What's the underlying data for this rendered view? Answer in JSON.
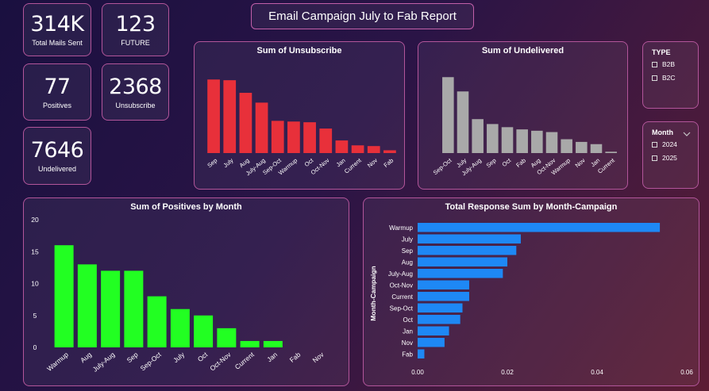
{
  "report": {
    "title": "Email Campaign July to Fab Report"
  },
  "kpis": [
    {
      "value": "314K",
      "label": "Total Mails Sent"
    },
    {
      "value": "123",
      "label": "FUTURE"
    },
    {
      "value": "77",
      "label": "Positives"
    },
    {
      "value": "2368",
      "label": "Unsubscribe"
    },
    {
      "value": "7646",
      "label": "Undelivered"
    }
  ],
  "slicers": {
    "type": {
      "header": "TYPE",
      "options": [
        "B2B",
        "B2C"
      ]
    },
    "month": {
      "header": "Month",
      "options": [
        "2024",
        "2025"
      ]
    }
  },
  "colors": {
    "unsubscribe": "#e8303a",
    "undelivered": "#a9a9a9",
    "positives": "#22ff22",
    "response": "#1e88f5"
  },
  "chart_data": [
    {
      "type": "bar",
      "title": "Sum of Unsubscribe",
      "categories": [
        "Sep",
        "July",
        "Aug",
        "July-Aug",
        "Sep-Oct",
        "Warmup",
        "Oct",
        "Oct-Nov",
        "Jan",
        "Current",
        "Nov",
        "Fab"
      ],
      "values": [
        525,
        520,
        430,
        360,
        230,
        225,
        220,
        175,
        90,
        55,
        50,
        20
      ],
      "ylim": [
        0,
        600
      ],
      "grid": false
    },
    {
      "type": "bar",
      "title": "Sum of Undelivered",
      "categories": [
        "Sep-Oct",
        "July",
        "July-Aug",
        "Sep",
        "Oct",
        "Fab",
        "Aug",
        "Oct-Nov",
        "Warmup",
        "Nov",
        "Jan",
        "Current"
      ],
      "values": [
        1700,
        1380,
        760,
        650,
        580,
        530,
        500,
        470,
        310,
        250,
        200,
        30
      ],
      "ylim": [
        0,
        1900
      ],
      "grid": false
    },
    {
      "type": "bar",
      "title": "Sum of Positives by Month",
      "categories": [
        "Warmup",
        "Aug",
        "July-Aug",
        "Sep",
        "Sep-Oct",
        "July",
        "Oct",
        "Oct-Nov",
        "Current",
        "Jan",
        "Fab",
        "Nov"
      ],
      "values": [
        16,
        13,
        12,
        12,
        8,
        6,
        5,
        3,
        1,
        1,
        0,
        0
      ],
      "ylim": [
        0,
        20
      ],
      "yticks": [
        "0",
        "5",
        "10",
        "15",
        "20"
      ],
      "grid": false
    },
    {
      "type": "bar",
      "orientation": "horizontal",
      "title": "Total Response Sum by Month-Campaign",
      "ylabel": "Month-Campaign",
      "categories": [
        "Warmup",
        "July",
        "Sep",
        "Aug",
        "July-Aug",
        "Oct-Nov",
        "Current",
        "Sep-Oct",
        "Oct",
        "Jan",
        "Nov",
        "Fab"
      ],
      "values": [
        0.054,
        0.023,
        0.022,
        0.02,
        0.019,
        0.0115,
        0.0115,
        0.01,
        0.0095,
        0.007,
        0.006,
        0.0015
      ],
      "xlim": [
        0,
        0.06
      ],
      "xticks": [
        "0.00",
        "0.02",
        "0.04",
        "0.06"
      ],
      "grid": false
    }
  ]
}
